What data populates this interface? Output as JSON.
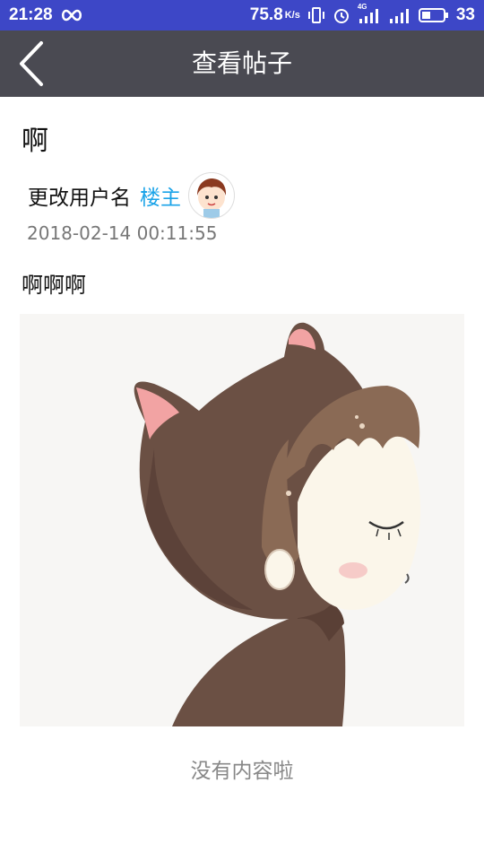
{
  "status_bar": {
    "time": "21:28",
    "speed": "75.8",
    "speed_unit": "K/s",
    "network": "4G",
    "battery": "33"
  },
  "header": {
    "title": "查看帖子",
    "back_icon": "chevron-left-icon"
  },
  "post": {
    "title": "啊",
    "author": "更改用户名",
    "badge": "楼主",
    "timestamp": "2018-02-14 00:11:55",
    "body": "啊啊啊"
  },
  "footer": {
    "end_text": "没有内容啦"
  },
  "colors": {
    "status_bar": "#3d47c7",
    "title_bar": "#4a4a52",
    "badge": "#1aa3e8"
  }
}
